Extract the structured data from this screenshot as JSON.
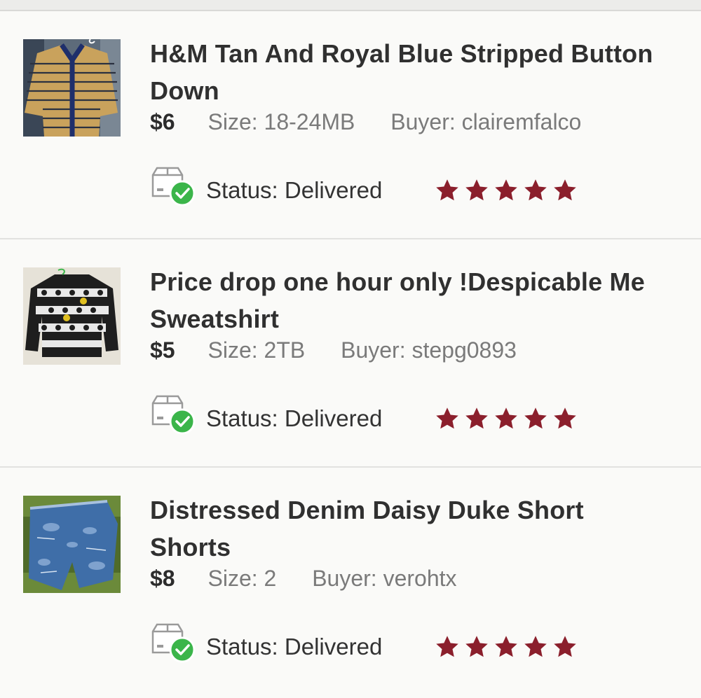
{
  "listings": [
    {
      "thumb": "striped-cardigan-photo",
      "title": "H&M Tan And Royal Blue Stripped Button Down",
      "price": "$6",
      "size_label": "Size:",
      "size_value": "18-24MB",
      "buyer_label": "Buyer:",
      "buyer_value": "clairemfalco",
      "status_label": "Status:",
      "status_value": "Delivered",
      "rating": 5
    },
    {
      "thumb": "patterned-sweatshirt-photo",
      "title": "Price drop one hour only !Despicable Me Sweatshirt",
      "price": "$5",
      "size_label": "Size:",
      "size_value": "2TB",
      "buyer_label": "Buyer:",
      "buyer_value": "stepg0893",
      "status_label": "Status:",
      "status_value": "Delivered",
      "rating": 5
    },
    {
      "thumb": "denim-shorts-photo",
      "title": "Distressed Denim Daisy Duke Short Shorts",
      "price": "$8",
      "size_label": "Size:",
      "size_value": "2",
      "buyer_label": "Buyer:",
      "buyer_value": "verohtx",
      "status_label": "Status:",
      "status_value": "Delivered",
      "rating": 5
    }
  ],
  "colors": {
    "star": "#8b1f2c",
    "check": "#3bb54a",
    "divider": "#e2e2e0"
  },
  "icons": {
    "status": "delivered-box-check-icon",
    "rating": "star-icon"
  }
}
